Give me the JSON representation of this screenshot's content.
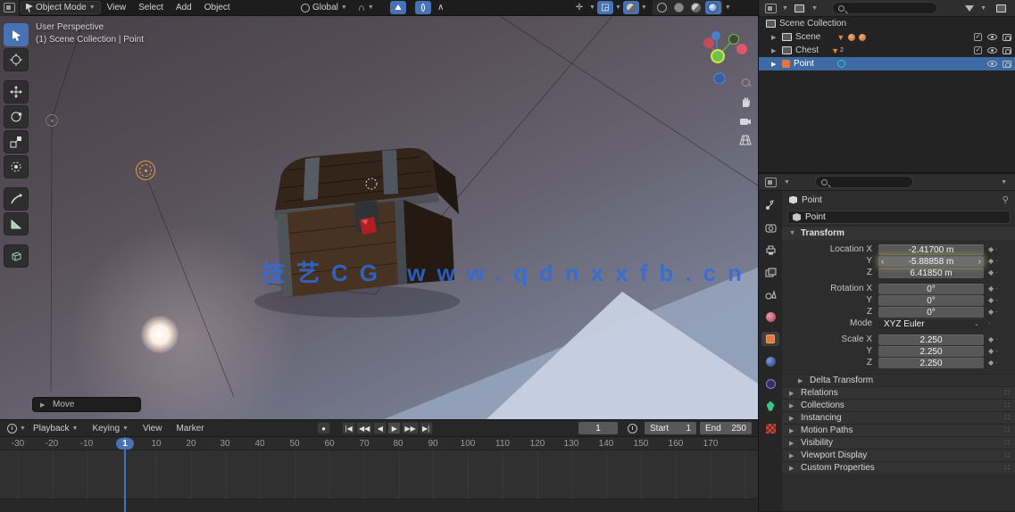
{
  "topbar": {
    "mode_label": "Object Mode",
    "menu_view": "View",
    "menu_select": "Select",
    "menu_add": "Add",
    "menu_object": "Object",
    "orientation_label": "Global",
    "icons": {
      "editor_type": "grid-editor-icon",
      "snap": "magnet-icon",
      "proportional": "circle-icon",
      "falloff": "curve-icon",
      "shading_modes": [
        "wireframe",
        "solid",
        "material-preview",
        "rendered"
      ]
    }
  },
  "viewport": {
    "overlay_line1": "User Perspective",
    "overlay_line2": "(1) Scene Collection | Point",
    "operator_panel_label": "Move",
    "watermark": "技艺CG www.qdnxxfb.cn",
    "tools": [
      "select-box",
      "cursor",
      "move",
      "rotate",
      "scale",
      "transform",
      "annotate",
      "measure",
      "add-cube"
    ]
  },
  "outliner": {
    "scene_collection": "Scene Collection",
    "rows": [
      {
        "label": "Scene"
      },
      {
        "label": "Chest",
        "mesh_count": "2"
      },
      {
        "label": "Point"
      }
    ]
  },
  "properties": {
    "breadcrumb": "Point",
    "name_field": "Point",
    "transform_header": "Transform",
    "rows": [
      {
        "label": "Location X",
        "value": "-2.41700 m"
      },
      {
        "label": "Y",
        "value": "-5.88858 m"
      },
      {
        "label": "Z",
        "value": "6.41850 m"
      },
      {
        "label": "Rotation X",
        "value": "0°"
      },
      {
        "label": "Y",
        "value": "0°"
      },
      {
        "label": "Z",
        "value": "0°"
      },
      {
        "label": "Mode",
        "value": "XYZ Euler"
      },
      {
        "label": "Scale X",
        "value": "2.250"
      },
      {
        "label": "Y",
        "value": "2.250"
      },
      {
        "label": "Z",
        "value": "2.250"
      }
    ],
    "sections": [
      "Delta Transform",
      "Relations",
      "Collections",
      "Instancing",
      "Motion Paths",
      "Visibility",
      "Viewport Display",
      "Custom Properties"
    ]
  },
  "timeline": {
    "menus": {
      "playback": "Playback",
      "keying": "Keying",
      "view": "View",
      "marker": "Marker"
    },
    "transport": {
      "jump_start": "|◀",
      "prev_key": "◀◀",
      "play_reverse": "◀",
      "play": "▶",
      "next_key": "▶▶",
      "jump_end": "▶|"
    },
    "record": "●",
    "current_frame": "1",
    "start_label": "Start",
    "start_value": "1",
    "end_label": "End",
    "end_value": "250",
    "badge_frame": "1",
    "ruler_labels": [
      "-30",
      "-20",
      "-10",
      "10",
      "20",
      "30",
      "40",
      "50",
      "60",
      "70",
      "80",
      "90",
      "100",
      "110",
      "120",
      "130",
      "140",
      "150",
      "160",
      "170"
    ]
  },
  "colors": {
    "accent_blue": "#4772b3",
    "selection_row": "#3d6aa5",
    "watermark_blue": "#2e6ce4",
    "lamp_gizmo_orange": "#e8a33d",
    "gem_red": "#b01e24"
  }
}
